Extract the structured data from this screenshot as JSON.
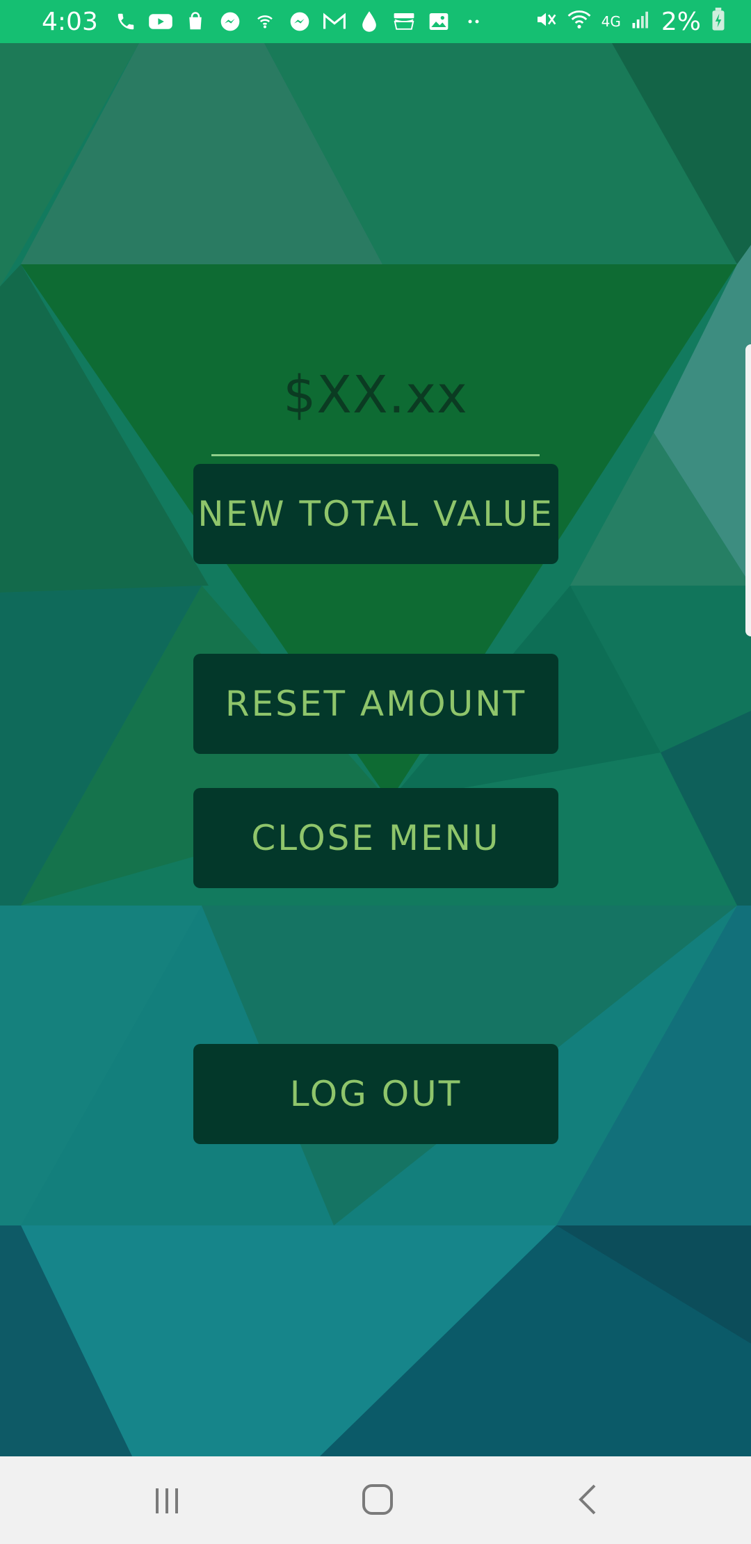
{
  "status_bar": {
    "time": "4:03",
    "battery_percent": "2%",
    "network": "4G",
    "left_icons": [
      "phone-icon",
      "youtube-icon",
      "shopping-bag-icon",
      "messenger-icon",
      "wifi-calling-icon",
      "messenger-icon",
      "gmail-icon",
      "water-drop-icon",
      "amazon-icon",
      "gallery-icon",
      "more-dots-icon"
    ],
    "right_icons": [
      "mute-icon",
      "wifi-icon",
      "signal-icon",
      "battery-icon"
    ]
  },
  "main": {
    "amount_placeholder": "$XX.xx",
    "buttons": {
      "new_total": "NEW TOTAL VALUE",
      "reset": "RESET AMOUNT",
      "close_menu": "CLOSE MENU",
      "log_out": "LOG OUT"
    }
  },
  "colors": {
    "status_bar": "#15bf72",
    "button_bg": "#03382a",
    "button_text": "#8fc56b",
    "amount_text": "#0b3b22",
    "nav_bar": "#f1f1f1"
  },
  "nav_bar": {
    "icons": [
      "recent-apps-icon",
      "home-icon",
      "back-icon"
    ]
  }
}
